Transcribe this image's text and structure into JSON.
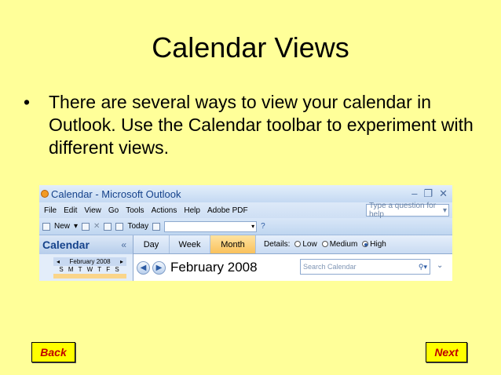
{
  "slide": {
    "title": "Calendar Views",
    "bullet_marker": "•",
    "bullet_text": "There are several ways to view your calendar in Outlook.  Use the Calendar toolbar to experiment with different views."
  },
  "outlook": {
    "window_title": "Calendar - Microsoft Outlook",
    "window_buttons": [
      "–",
      "❐",
      "✕"
    ],
    "menu": [
      "File",
      "Edit",
      "View",
      "Go",
      "Tools",
      "Actions",
      "Help",
      "Adobe PDF"
    ],
    "help_placeholder": "Type a question for help",
    "toolbar": {
      "new_label": "New",
      "today_label": "Today"
    },
    "nav_pane": {
      "title": "Calendar",
      "collapse": "«",
      "mini_month": "February 2008",
      "mini_days": "S M T W T F S"
    },
    "views": {
      "day": "Day",
      "week": "Week",
      "month": "Month",
      "selected": "Month"
    },
    "details": {
      "label": "Details:",
      "options": [
        "Low",
        "Medium",
        "High"
      ],
      "selected": "High"
    },
    "current_period": "February 2008",
    "search_placeholder": "Search Calendar"
  },
  "buttons": {
    "back": "Back",
    "next": "Next"
  },
  "colors": {
    "slide_bg": "#FFFF99",
    "button_fill": "#FFFF00",
    "button_text": "#C00000"
  }
}
